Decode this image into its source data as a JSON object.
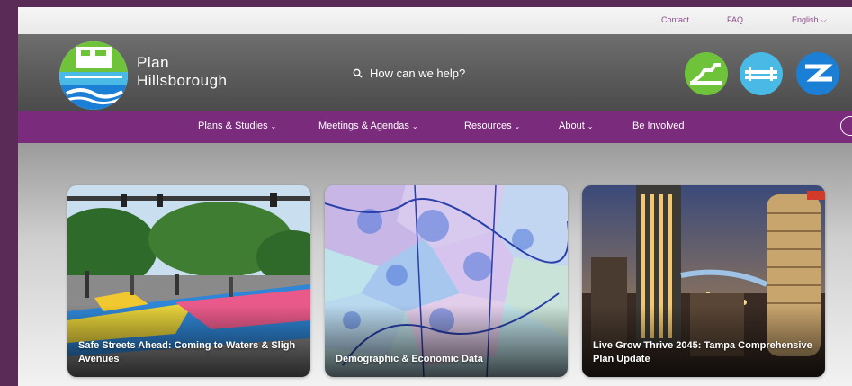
{
  "utility": {
    "links": [
      "Contact",
      "FAQ"
    ],
    "language": "English"
  },
  "brand": {
    "line1": "Plan",
    "line2": "Hillsborough"
  },
  "search": {
    "label": "How can we help?"
  },
  "icons": [
    "logo-icon",
    "bicycle-icon",
    "bridge-icon",
    "river-icon",
    "search-icon"
  ],
  "nav": {
    "items": [
      {
        "label": "Plans & Studies",
        "dropdown": true
      },
      {
        "label": "Meetings & Agendas",
        "dropdown": true
      },
      {
        "label": "Resources",
        "dropdown": true
      },
      {
        "label": "About",
        "dropdown": true
      },
      {
        "label": "Be Involved",
        "dropdown": false
      }
    ]
  },
  "cards": [
    {
      "title": "Safe Streets Ahead: Coming to Waters & Sligh Avenues"
    },
    {
      "title": "Demographic & Economic Data"
    },
    {
      "title": "Live Grow Thrive 2045: Tampa Comprehensive Plan Update"
    }
  ],
  "colors": {
    "purple": "#7b2b7c",
    "outer": "#5a2b57",
    "green": "#6fc33b",
    "blue": "#1c7fd6",
    "light-blue": "#49b9e6"
  }
}
